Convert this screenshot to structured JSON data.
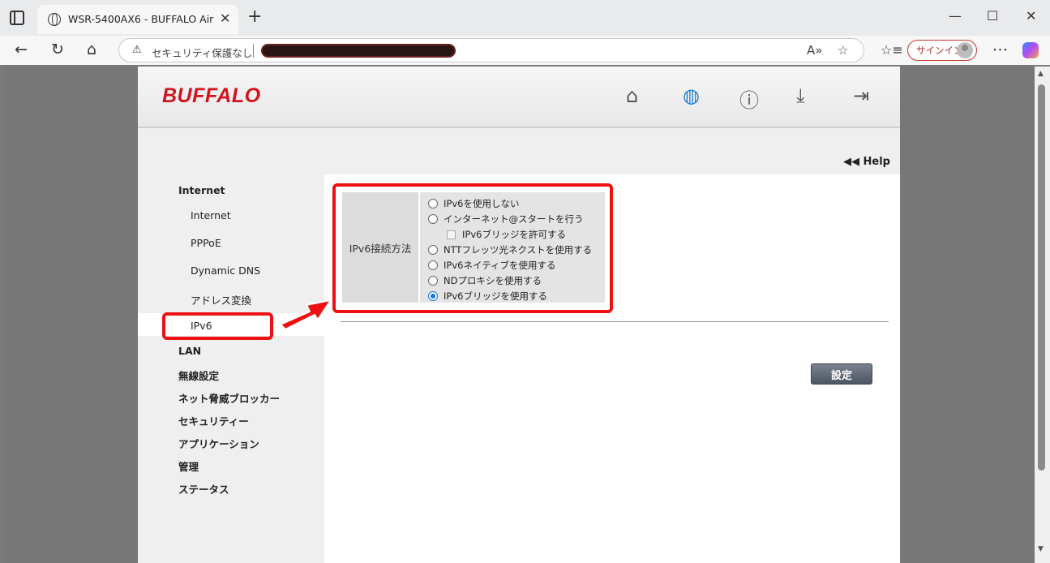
{
  "browser": {
    "tab_title": "WSR-5400AX6 - BUFFALO AirStation",
    "tab_close": "✕",
    "new_tab": "+",
    "security_label": "セキュリティ保護なし",
    "signin_label": "サインイン",
    "window_controls": {
      "minimize": "—",
      "maximize": "☐",
      "close": "✕"
    }
  },
  "router": {
    "logo": "BUFFALO",
    "header_icons": [
      "home-icon",
      "globe-icon",
      "info-icon",
      "download-icon",
      "logout-icon"
    ],
    "help_label": "◀◀ Help",
    "sidebar": {
      "section_internet": "Internet",
      "sub_items": [
        "Internet",
        "PPPoE",
        "Dynamic DNS",
        "アドレス変換",
        "IPv6"
      ],
      "sections": [
        "LAN",
        "無線設定",
        "ネット脅威ブロッカー",
        "セキュリティー",
        "アプリケーション",
        "管理",
        "ステータス"
      ]
    },
    "form": {
      "label": "IPv6接続方法",
      "options": [
        "IPv6を使用しない",
        "インターネット@スタートを行う",
        "IPv6ブリッジを許可する",
        "NTTフレッツ光ネクストを使用する",
        "IPv6ネイティブを使用する",
        "NDプロキシを使用する",
        "IPv6ブリッジを使用する"
      ],
      "selected": "IPv6ブリッジを使用する",
      "submit_label": "設定"
    },
    "accent_color": "#d0141e",
    "annotation_color": "#ee1111"
  }
}
